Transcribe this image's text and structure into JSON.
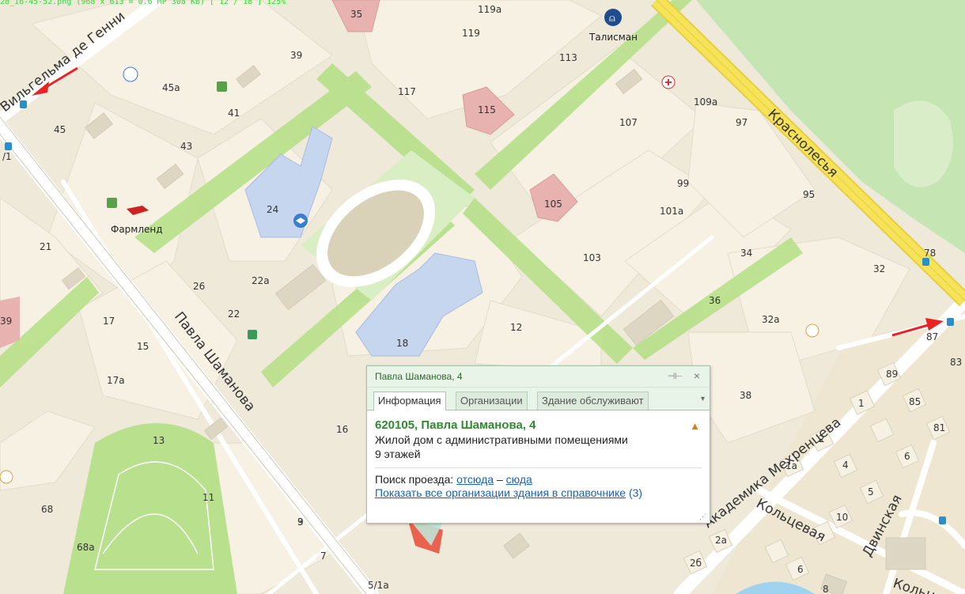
{
  "hud_text": "28_16-45-52.png (968 x 613 = 0.6 MP   308 KB) [ 12 / 18 ]  125%",
  "colors": {
    "background": "#eee9d9",
    "block": "#f6f1e2",
    "park": "#b9e08d",
    "road": "#ffffff",
    "highway": "#f6e35a",
    "forest": "#c5e5b3",
    "school": "#c7d6ef",
    "hospital": "#e8b2b0",
    "marker": "#e23b3b"
  },
  "streets": [
    "Вильгельма де Генни",
    "Павла Шаманова",
    "Краснолесья",
    "Академика Мехренцева",
    "Кольцевая",
    "Двинская",
    "Кольцевая"
  ],
  "house_numbers": [
    "35",
    "119а",
    "119",
    "39",
    "45а",
    "113",
    "117",
    "115",
    "41",
    "109а",
    "45",
    "43",
    "107",
    "97",
    "105",
    "99",
    "95",
    "101а",
    "24",
    "21",
    "103",
    "34",
    "78",
    "32",
    "26",
    "22а",
    "36",
    "22",
    "32а",
    "17",
    "15",
    "18",
    "12",
    "87",
    "83",
    "89",
    "17а",
    "85",
    "38",
    "1",
    "13",
    "81",
    "16",
    "6",
    "2",
    "11",
    "3",
    "4",
    "1а",
    "5",
    "68",
    "10",
    "9",
    "68а",
    "7",
    "6",
    "2а",
    "8",
    "5/1а",
    "2б",
    "/1",
    "39"
  ],
  "pois": {
    "talisman": "Талисман",
    "farmlend": "Фармленд"
  },
  "balloon": {
    "title": "Павла Шаманова, 4",
    "tabs": [
      "Информация",
      "Организации",
      "Здание обслуживают"
    ],
    "address": "620105, Павла Шаманова, 4",
    "description": "Жилой дом с административными помещениями",
    "floors": "9 этажей",
    "route_label": "Поиск проезда:",
    "route_from": "отсюда",
    "route_dash": "–",
    "route_to": "сюда",
    "all_orgs_link": "Показать все организации здания в справочнике",
    "all_orgs_count": "(3)"
  }
}
